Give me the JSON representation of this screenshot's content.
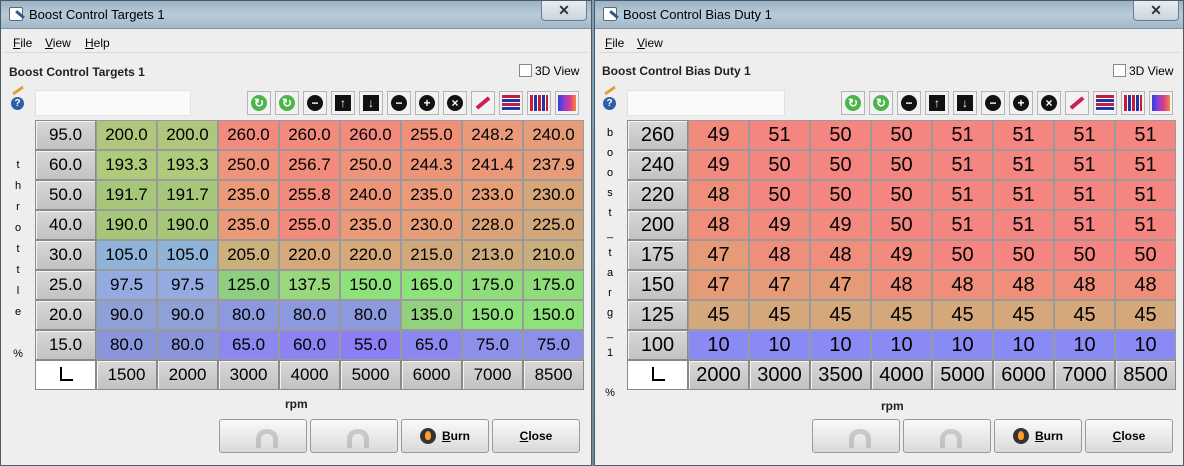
{
  "win1": {
    "title": "Boost Control Targets 1",
    "menu": [
      {
        "label": "File",
        "key": "F",
        "rest": "ile"
      },
      {
        "label": "View",
        "key": "V",
        "rest": "iew"
      },
      {
        "label": "Help",
        "key": "H",
        "rest": "elp"
      }
    ],
    "table_label": "Boost Control Targets 1",
    "view3d_label": "3D View",
    "y_axis_label": [
      "t",
      "h",
      "r",
      "o",
      "t",
      "t",
      "l",
      "e",
      "",
      "%"
    ],
    "x_axis_label": "rpm",
    "row_headers": [
      "95.0",
      "60.0",
      "50.0",
      "40.0",
      "30.0",
      "25.0",
      "20.0",
      "15.0"
    ],
    "col_headers": [
      "1500",
      "2000",
      "3000",
      "4000",
      "5000",
      "6000",
      "7000",
      "8500"
    ],
    "cells": [
      [
        "200.0",
        "200.0",
        "260.0",
        "260.0",
        "260.0",
        "255.0",
        "248.2",
        "240.0"
      ],
      [
        "193.3",
        "193.3",
        "250.0",
        "256.7",
        "250.0",
        "244.3",
        "241.4",
        "237.9"
      ],
      [
        "191.7",
        "191.7",
        "235.0",
        "255.8",
        "240.0",
        "235.0",
        "233.0",
        "230.0"
      ],
      [
        "190.0",
        "190.0",
        "235.0",
        "255.0",
        "235.0",
        "230.0",
        "228.0",
        "225.0"
      ],
      [
        "105.0",
        "105.0",
        "205.0",
        "220.0",
        "220.0",
        "215.0",
        "213.0",
        "210.0"
      ],
      [
        "97.5",
        "97.5",
        "125.0",
        "137.5",
        "150.0",
        "165.0",
        "175.0",
        "175.0"
      ],
      [
        "90.0",
        "90.0",
        "80.0",
        "80.0",
        "80.0",
        "135.0",
        "150.0",
        "150.0"
      ],
      [
        "80.0",
        "80.0",
        "65.0",
        "60.0",
        "55.0",
        "65.0",
        "75.0",
        "75.0"
      ]
    ],
    "cell_colors": [
      [
        "#b1c67d",
        "#b1c67d",
        "#f28a7d",
        "#f28a7d",
        "#f28a7d",
        "#f09079",
        "#ea9a78",
        "#e49d78"
      ],
      [
        "#aecb7c",
        "#aecb7c",
        "#ef937b",
        "#f28b7c",
        "#ef937b",
        "#ec9478",
        "#eb9878",
        "#e49d78"
      ],
      [
        "#a6c77a",
        "#a6c77a",
        "#ea9a78",
        "#f28b7c",
        "#ee9579",
        "#ea9a78",
        "#e59e78",
        "#d7a57a"
      ],
      [
        "#a6c77a",
        "#a6c77a",
        "#ea9a78",
        "#f28b7c",
        "#ea9a78",
        "#e59e78",
        "#dba279",
        "#d0a87b"
      ],
      [
        "#8fb3d9",
        "#8fb3d9",
        "#cbb07c",
        "#d7a97a",
        "#d7a97a",
        "#d0a87b",
        "#cdab7c",
        "#c9ad7c"
      ],
      [
        "#94aae0",
        "#94aae0",
        "#8ecf7f",
        "#97d97c",
        "#8ee27b",
        "#8ee27b",
        "#8fdc7b",
        "#8fdc7b"
      ],
      [
        "#8fa0d6",
        "#8fa0d6",
        "#8d99de",
        "#8d99de",
        "#8d99de",
        "#92d27f",
        "#8ee27b",
        "#8ee27b"
      ],
      [
        "#8a96dc",
        "#8a96dc",
        "#8b88f0",
        "#8c82f2",
        "#8c7ef5",
        "#8b88f0",
        "#8c90e8",
        "#8c90e8"
      ]
    ],
    "buttons": {
      "burn": "Burn",
      "burn_key": "B",
      "burn_rest": "urn",
      "close": "Close",
      "close_key": "C",
      "close_rest": "lose"
    }
  },
  "win2": {
    "title": "Boost Control Bias Duty 1",
    "menu": [
      {
        "label": "File",
        "key": "F",
        "rest": "ile"
      },
      {
        "label": "View",
        "key": "V",
        "rest": "iew"
      }
    ],
    "table_label": "Boost Control Bias Duty 1",
    "view3d_label": "3D View",
    "y_axis_label": [
      "b",
      "o",
      "o",
      "s",
      "t",
      "_",
      "t",
      "a",
      "r",
      "g",
      "_",
      "1",
      "",
      "%"
    ],
    "x_axis_label": "rpm",
    "row_headers": [
      "260",
      "240",
      "220",
      "200",
      "175",
      "150",
      "125",
      "100"
    ],
    "col_headers": [
      "2000",
      "3000",
      "3500",
      "4000",
      "5000",
      "6000",
      "7000",
      "8500"
    ],
    "cells": [
      [
        "49",
        "51",
        "50",
        "50",
        "51",
        "51",
        "51",
        "51"
      ],
      [
        "49",
        "50",
        "50",
        "50",
        "51",
        "51",
        "51",
        "51"
      ],
      [
        "48",
        "50",
        "50",
        "50",
        "51",
        "51",
        "51",
        "51"
      ],
      [
        "48",
        "49",
        "49",
        "50",
        "51",
        "51",
        "51",
        "51"
      ],
      [
        "47",
        "48",
        "48",
        "49",
        "50",
        "50",
        "50",
        "50"
      ],
      [
        "47",
        "47",
        "47",
        "48",
        "48",
        "48",
        "48",
        "48"
      ],
      [
        "45",
        "45",
        "45",
        "45",
        "45",
        "45",
        "45",
        "45"
      ],
      [
        "10",
        "10",
        "10",
        "10",
        "10",
        "10",
        "10",
        "10"
      ]
    ],
    "cell_colors": [
      [
        "#f28a7d",
        "#f58580",
        "#f58580",
        "#f58580",
        "#f58580",
        "#f58580",
        "#f58580",
        "#f58580"
      ],
      [
        "#f28a7d",
        "#f58580",
        "#f58580",
        "#f58580",
        "#f58580",
        "#f58580",
        "#f58580",
        "#f58580"
      ],
      [
        "#ef8f7b",
        "#f58580",
        "#f58580",
        "#f58580",
        "#f58580",
        "#f58580",
        "#f58580",
        "#f58580"
      ],
      [
        "#ef8f7b",
        "#f28a7d",
        "#f28a7d",
        "#f58580",
        "#f58580",
        "#f58580",
        "#f58580",
        "#f58580"
      ],
      [
        "#e59a78",
        "#ef8f7b",
        "#ef8f7b",
        "#f28a7d",
        "#f58580",
        "#f58580",
        "#f58580",
        "#f58580"
      ],
      [
        "#e59a78",
        "#e59a78",
        "#e59a78",
        "#ef8f7b",
        "#ef8f7b",
        "#ef8f7b",
        "#ef8f7b",
        "#ef8f7b"
      ],
      [
        "#d4a87b",
        "#d4a87b",
        "#d4a87b",
        "#d4a87b",
        "#d4a87b",
        "#d4a87b",
        "#d4a87b",
        "#d4a87b"
      ],
      [
        "#8a8af5",
        "#8a8af5",
        "#8a8af5",
        "#8a8af5",
        "#8a8af5",
        "#8a8af5",
        "#8a8af5",
        "#8a8af5"
      ]
    ],
    "buttons": {
      "burn": "Burn",
      "burn_key": "B",
      "burn_rest": "urn",
      "close": "Close",
      "close_key": "C",
      "close_rest": "lose"
    }
  },
  "toolbar_icons": [
    "increment-fine-icon",
    "increment-coarse-icon",
    "decrement-icon",
    "shift-up-icon",
    "shift-down-icon",
    "minus-icon",
    "plus-icon",
    "clear-icon",
    "pencil-icon",
    "hbar-color-icon",
    "vbar-color-icon",
    "gradient-color-icon"
  ],
  "colors": {
    "header_bg": "#c8c8c8",
    "window_bg": "#eeeeee"
  }
}
